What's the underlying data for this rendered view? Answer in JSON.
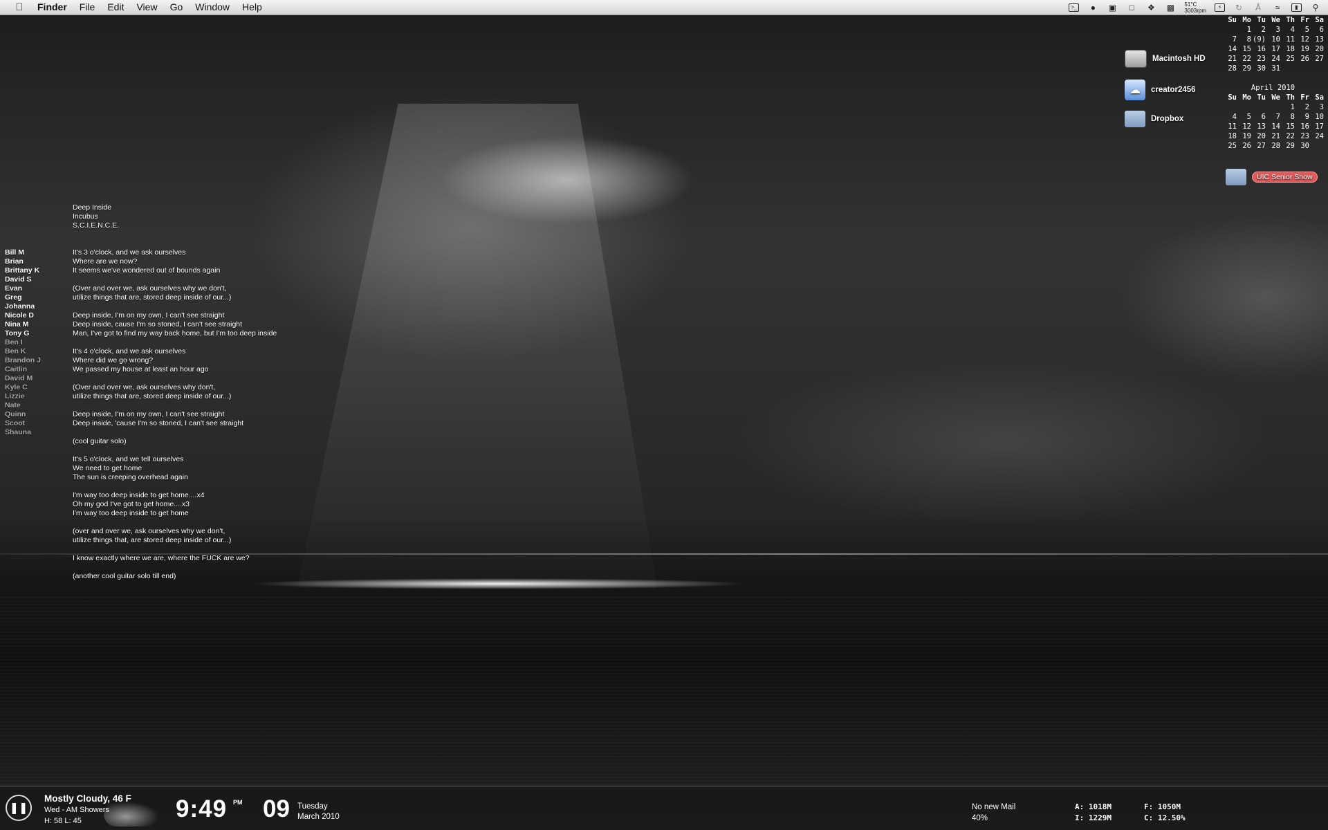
{
  "menubar": {
    "apple": "",
    "items": [
      "Finder",
      "File",
      "Edit",
      "View",
      "Go",
      "Window",
      "Help"
    ],
    "status": {
      "temp": "51°C",
      "fan": "3003rpm"
    }
  },
  "calendar_march": {
    "title": "",
    "days": [
      "Su",
      "Mo",
      "Tu",
      "We",
      "Th",
      "Fr",
      "Sa"
    ],
    "weeks": [
      [
        "",
        "1",
        "2",
        "3",
        "4",
        "5",
        "6"
      ],
      [
        "7",
        "8",
        "(9)",
        "10",
        "11",
        "12",
        "13"
      ],
      [
        "14",
        "15",
        "16",
        "17",
        "18",
        "19",
        "20"
      ],
      [
        "21",
        "22",
        "23",
        "24",
        "25",
        "26",
        "27"
      ],
      [
        "28",
        "29",
        "30",
        "31",
        "",
        "",
        ""
      ]
    ]
  },
  "calendar_april": {
    "title": "April 2010",
    "days": [
      "Su",
      "Mo",
      "Tu",
      "We",
      "Th",
      "Fr",
      "Sa"
    ],
    "weeks": [
      [
        "",
        "",
        "",
        "",
        "1",
        "2",
        "3"
      ],
      [
        "4",
        "5",
        "6",
        "7",
        "8",
        "9",
        "10"
      ],
      [
        "11",
        "12",
        "13",
        "14",
        "15",
        "16",
        "17"
      ],
      [
        "18",
        "19",
        "20",
        "21",
        "22",
        "23",
        "24"
      ],
      [
        "25",
        "26",
        "27",
        "28",
        "29",
        "30",
        ""
      ]
    ]
  },
  "desktop_icons": {
    "macintosh_hd": "Macintosh HD",
    "creator": "creator2456",
    "dropbox": "Dropbox",
    "senior_show": "UIC Senior Show"
  },
  "song": {
    "title": "Deep Inside",
    "artist": "Incubus",
    "album": "S.C.I.E.N.C.E.",
    "lyrics": [
      "It's 3 o'clock, and we ask ourselves",
      "Where are we now?",
      "It seems we've wondered out of bounds again",
      "",
      "(Over and over we, ask ourselves why we don't,",
      "utilize things that are, stored deep inside of our...)",
      "",
      "Deep inside, I'm on my own, I can't see straight",
      "Deep inside, cause I'm so stoned, I can't see straight",
      "Man, I've got to find my way back home, but I'm too deep inside",
      "",
      "It's 4 o'clock, and we ask ourselves",
      "Where did we go wrong?",
      "We passed my house at least an hour ago",
      "",
      "(Over and over we, ask ourselves why don't,",
      "utilize things that are, stored deep inside of our...)",
      "",
      "Deep inside, I'm on my own, I can't see straight",
      "Deep inside, 'cause I'm so stoned, I can't see straight",
      "",
      "(cool guitar solo)",
      "",
      "It's 5 o'clock, and we tell ourselves",
      "We need to get home",
      "The sun is creeping overhead again",
      "",
      "I'm way too deep inside to get home....x4",
      "Oh my god I've got to get home....x3",
      "I'm way too deep inside to get home",
      "",
      "(over and over we, ask ourselves why we don't,",
      "utilize things that, are stored deep inside of our...)",
      "",
      "I know exactly where we are, where the FUCK are we?",
      "",
      "(another cool guitar solo till end)"
    ]
  },
  "names": [
    {
      "name": "Bill M",
      "faded": false
    },
    {
      "name": "Brian",
      "faded": false
    },
    {
      "name": "Brittany K",
      "faded": false
    },
    {
      "name": "David S",
      "faded": false
    },
    {
      "name": "Evan",
      "faded": false
    },
    {
      "name": "Greg",
      "faded": false
    },
    {
      "name": "Johanna",
      "faded": false
    },
    {
      "name": "Nicole D",
      "faded": false
    },
    {
      "name": "Nina M",
      "faded": false
    },
    {
      "name": "Tony G",
      "faded": false
    },
    {
      "name": "Ben I",
      "faded": true
    },
    {
      "name": "Ben K",
      "faded": true
    },
    {
      "name": "Brandon J",
      "faded": true
    },
    {
      "name": "Caitlin",
      "faded": true
    },
    {
      "name": "David M",
      "faded": true
    },
    {
      "name": "Kyle C",
      "faded": true
    },
    {
      "name": "Lizzie",
      "faded": true
    },
    {
      "name": "Nate",
      "faded": true
    },
    {
      "name": "Quinn",
      "faded": true
    },
    {
      "name": "Scoot",
      "faded": true
    },
    {
      "name": "Shauna",
      "faded": true
    }
  ],
  "weather": {
    "current": "Mostly Cloudy, 46 F",
    "forecast": "Wed - AM Showers",
    "hilo": "H: 58  L: 45"
  },
  "clock": {
    "time": "9:49",
    "ampm": "PM",
    "day_num": "09",
    "weekday": "Tuesday",
    "month_year": "March 2010"
  },
  "mail": {
    "status": "No new Mail",
    "percent": "40%"
  },
  "stats": {
    "a": "A: 1018M",
    "f": "F: 1050M",
    "i": "I: 1229M",
    "c": "C: 12.50%"
  }
}
